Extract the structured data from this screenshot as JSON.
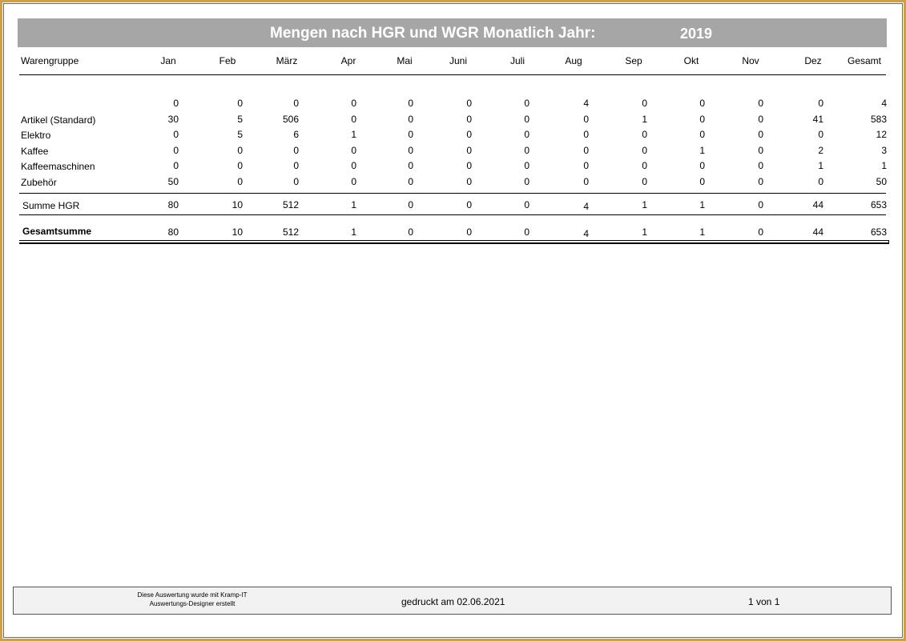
{
  "report": {
    "title": "Mengen nach HGR und WGR Monatlich Jahr:",
    "year": "2019"
  },
  "columns": [
    "Warengruppe",
    "Jan",
    "Feb",
    "März",
    "Apr",
    "Mai",
    "Juni",
    "Juli",
    "Aug",
    "Sep",
    "Okt",
    "Nov",
    "Dez",
    "Gesamt"
  ],
  "rows": [
    {
      "label": "",
      "values": [
        "0",
        "0",
        "0",
        "0",
        "0",
        "0",
        "0",
        "4",
        "0",
        "0",
        "0",
        "0",
        "4"
      ]
    },
    {
      "label": "Artikel (Standard)",
      "values": [
        "30",
        "5",
        "506",
        "0",
        "0",
        "0",
        "0",
        "0",
        "1",
        "0",
        "0",
        "41",
        "583"
      ]
    },
    {
      "label": "Elektro",
      "values": [
        "0",
        "5",
        "6",
        "1",
        "0",
        "0",
        "0",
        "0",
        "0",
        "0",
        "0",
        "0",
        "12"
      ]
    },
    {
      "label": "Kaffee",
      "values": [
        "0",
        "0",
        "0",
        "0",
        "0",
        "0",
        "0",
        "0",
        "0",
        "1",
        "0",
        "2",
        "3"
      ]
    },
    {
      "label": "Kaffeemaschinen",
      "values": [
        "0",
        "0",
        "0",
        "0",
        "0",
        "0",
        "0",
        "0",
        "0",
        "0",
        "0",
        "1",
        "1"
      ]
    },
    {
      "label": "Zubehör",
      "values": [
        "50",
        "0",
        "0",
        "0",
        "0",
        "0",
        "0",
        "0",
        "0",
        "0",
        "0",
        "0",
        "50"
      ]
    }
  ],
  "summe_hgr": {
    "label": "Summe HGR",
    "values": [
      "80",
      "10",
      "512",
      "1",
      "0",
      "0",
      "0",
      "4",
      "1",
      "1",
      "0",
      "44",
      "653"
    ]
  },
  "gesamtsumme": {
    "label": "Gesamtsumme",
    "values": [
      "80",
      "10",
      "512",
      "1",
      "0",
      "0",
      "0",
      "4",
      "1",
      "1",
      "0",
      "44",
      "653"
    ]
  },
  "footer": {
    "note_line1": "Diese Auswertung wurde mit Kramp-IT",
    "note_line2": "Auswertungs-Designer erstellt",
    "printed": "gedruckt  am 02.06.2021",
    "page": "1 von 1"
  }
}
